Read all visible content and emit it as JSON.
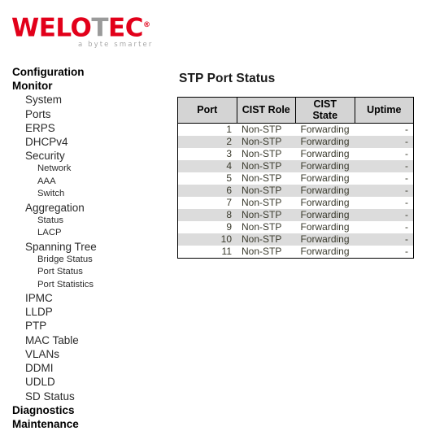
{
  "logo": {
    "word_part1": "WELO",
    "word_part2": "T",
    "word_part3": "EC",
    "registered_mark": "®",
    "tagline": "a byte smarter"
  },
  "sidebar": {
    "items": [
      {
        "label": "Configuration",
        "level": 1
      },
      {
        "label": "Monitor",
        "level": 1
      },
      {
        "label": "System",
        "level": 2
      },
      {
        "label": "Ports",
        "level": 2
      },
      {
        "label": "ERPS",
        "level": 2
      },
      {
        "label": "DHCPv4",
        "level": 2
      },
      {
        "label": "Security",
        "level": 2
      },
      {
        "label": "Network",
        "level": 3
      },
      {
        "label": "AAA",
        "level": 3
      },
      {
        "label": "Switch",
        "level": 3
      },
      {
        "label": "Aggregation",
        "level": 2
      },
      {
        "label": "Status",
        "level": 3
      },
      {
        "label": "LACP",
        "level": 3
      },
      {
        "label": "Spanning Tree",
        "level": 2
      },
      {
        "label": "Bridge Status",
        "level": 3
      },
      {
        "label": "Port Status",
        "level": 3
      },
      {
        "label": "Port Statistics",
        "level": 3
      },
      {
        "label": "IPMC",
        "level": 2
      },
      {
        "label": "LLDP",
        "level": 2
      },
      {
        "label": "PTP",
        "level": 2
      },
      {
        "label": "MAC Table",
        "level": 2
      },
      {
        "label": "VLANs",
        "level": 2
      },
      {
        "label": "DDMI",
        "level": 2
      },
      {
        "label": "UDLD",
        "level": 2
      },
      {
        "label": "SD Status",
        "level": 2
      },
      {
        "label": "Diagnostics",
        "level": 1
      },
      {
        "label": "Maintenance",
        "level": 1
      }
    ]
  },
  "main": {
    "title": "STP Port Status",
    "table": {
      "columns": [
        "Port",
        "CIST Role",
        "CIST State",
        "Uptime"
      ],
      "rows": [
        {
          "port": "1",
          "cist_role": "Non-STP",
          "cist_state": "Forwarding",
          "uptime": "-"
        },
        {
          "port": "2",
          "cist_role": "Non-STP",
          "cist_state": "Forwarding",
          "uptime": "-"
        },
        {
          "port": "3",
          "cist_role": "Non-STP",
          "cist_state": "Forwarding",
          "uptime": "-"
        },
        {
          "port": "4",
          "cist_role": "Non-STP",
          "cist_state": "Forwarding",
          "uptime": "-"
        },
        {
          "port": "5",
          "cist_role": "Non-STP",
          "cist_state": "Forwarding",
          "uptime": "-"
        },
        {
          "port": "6",
          "cist_role": "Non-STP",
          "cist_state": "Forwarding",
          "uptime": "-"
        },
        {
          "port": "7",
          "cist_role": "Non-STP",
          "cist_state": "Forwarding",
          "uptime": "-"
        },
        {
          "port": "8",
          "cist_role": "Non-STP",
          "cist_state": "Forwarding",
          "uptime": "-"
        },
        {
          "port": "9",
          "cist_role": "Non-STP",
          "cist_state": "Forwarding",
          "uptime": "-"
        },
        {
          "port": "10",
          "cist_role": "Non-STP",
          "cist_state": "Forwarding",
          "uptime": "-"
        },
        {
          "port": "11",
          "cist_role": "Non-STP",
          "cist_state": "Forwarding",
          "uptime": "-"
        }
      ]
    }
  },
  "colors": {
    "brand_red": "#e2001a",
    "logo_gray": "#9a9a9a",
    "header_bg": "#d4d4d4",
    "row_alt_bg": "#dcdcdc",
    "table_border": "#000000"
  }
}
